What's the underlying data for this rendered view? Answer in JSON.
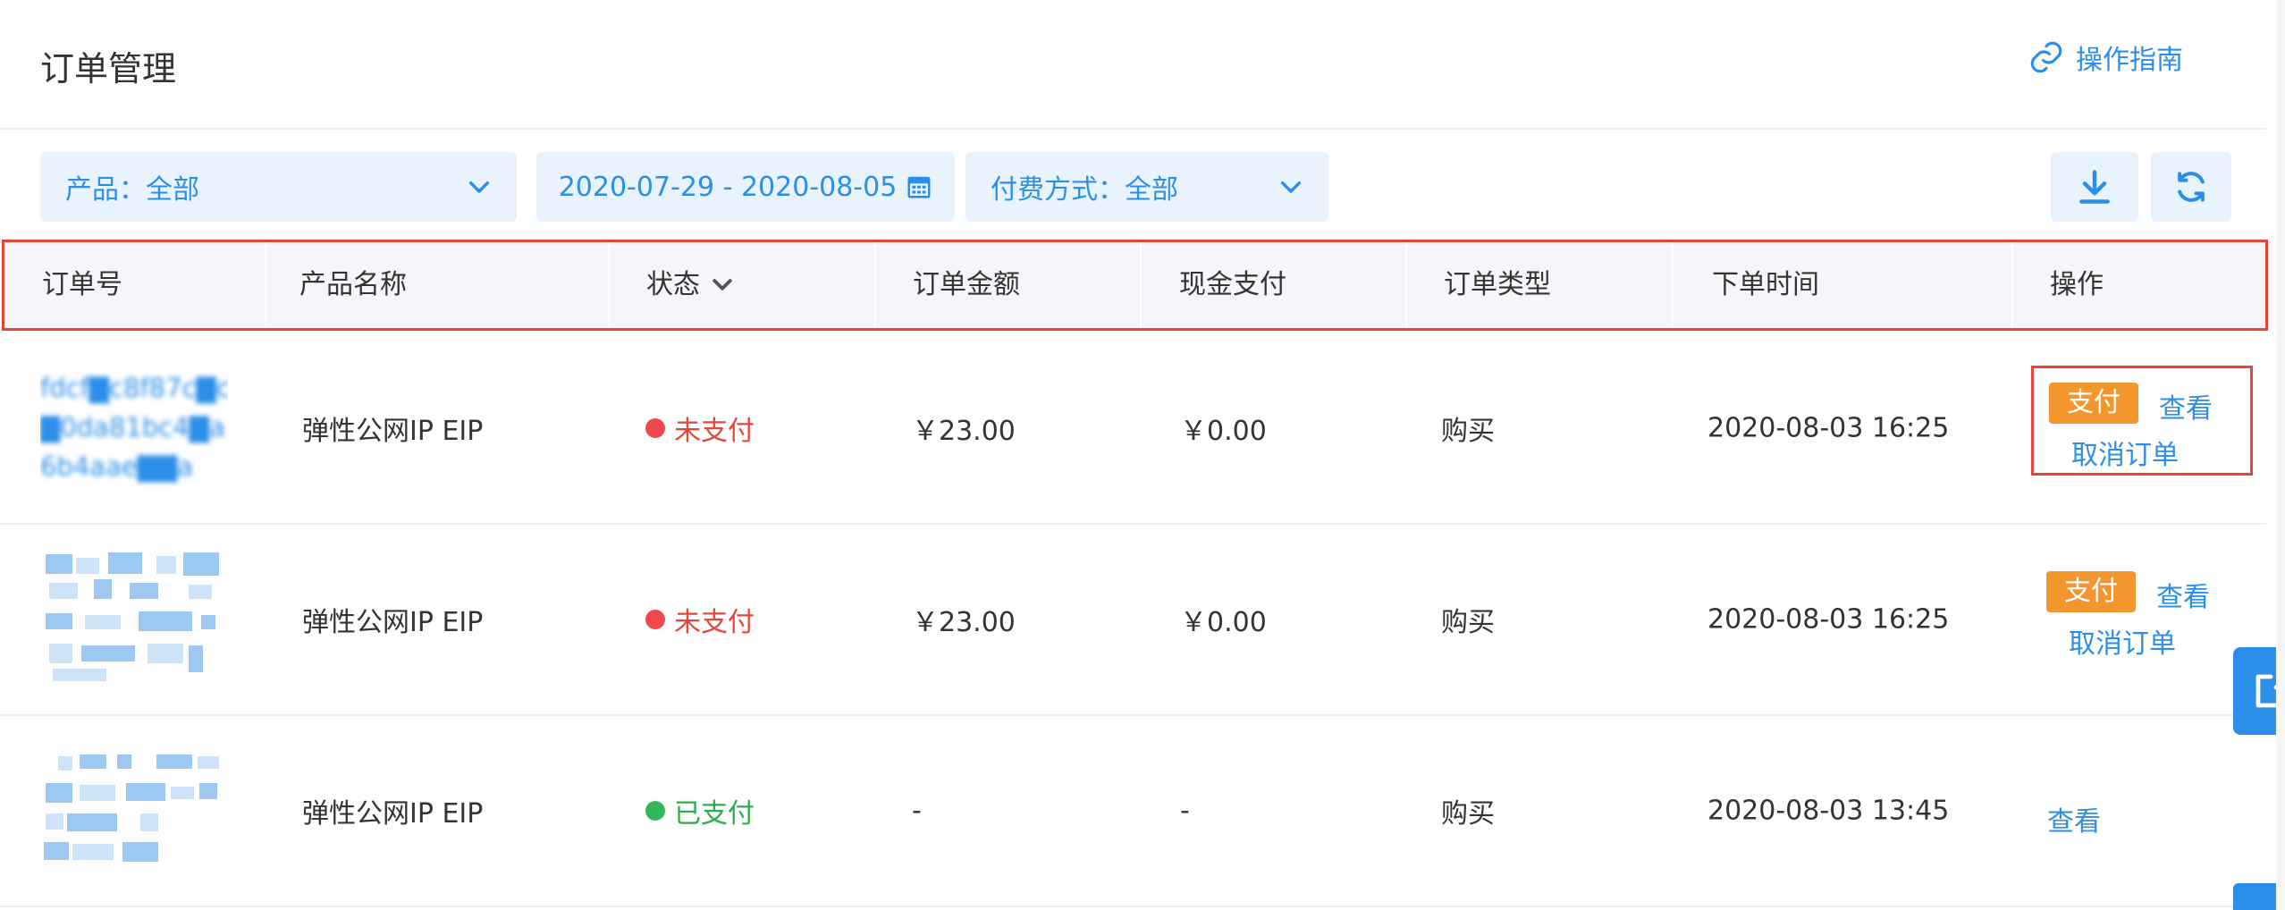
{
  "header": {
    "title": "订单管理",
    "guide_label": "操作指南"
  },
  "filters": {
    "product": "产品：全部",
    "date_range": "2020-07-29 - 2020-08-05",
    "payment": "付费方式：全部"
  },
  "table": {
    "columns": [
      "订单号",
      "产品名称",
      "状态",
      "订单金额",
      "现金支付",
      "订单类型",
      "下单时间",
      "操作"
    ],
    "rows": [
      {
        "order_id_lines": [
          "fdcf▇c8f87c▇c",
          "▇0da81bc4▇a",
          "6b4aae▇▇a"
        ],
        "product": "弹性公网IP EIP",
        "status": "未支付",
        "amount": "￥23.00",
        "cash": "￥0.00",
        "type": "购买",
        "time": "2020-08-03 16:25",
        "actions": {
          "pay": "支付",
          "view": "查看",
          "cancel": "取消订单"
        }
      },
      {
        "product": "弹性公网IP EIP",
        "status": "未支付",
        "amount": "￥23.00",
        "cash": "￥0.00",
        "type": "购买",
        "time": "2020-08-03 16:25",
        "actions": {
          "pay": "支付",
          "view": "查看",
          "cancel": "取消订单"
        }
      },
      {
        "product": "弹性公网IP EIP",
        "status": "已支付",
        "amount": "-",
        "cash": "-",
        "type": "购买",
        "time": "2020-08-03 13:45",
        "actions": {
          "view": "查看"
        }
      }
    ]
  },
  "colors": {
    "accent": "#2b8ee8",
    "filter_bg": "#e8f3fd",
    "pay_button": "#f4962e",
    "unpaid": "#e6463a",
    "paid": "#2aae4a",
    "highlight_box": "#e6463a"
  },
  "icons": {
    "guide": "link-icon",
    "dropdown": "chevron-down-icon",
    "date": "calendar-icon",
    "download": "download-icon",
    "refresh": "refresh-icon",
    "side_tab": "edit-icon"
  }
}
